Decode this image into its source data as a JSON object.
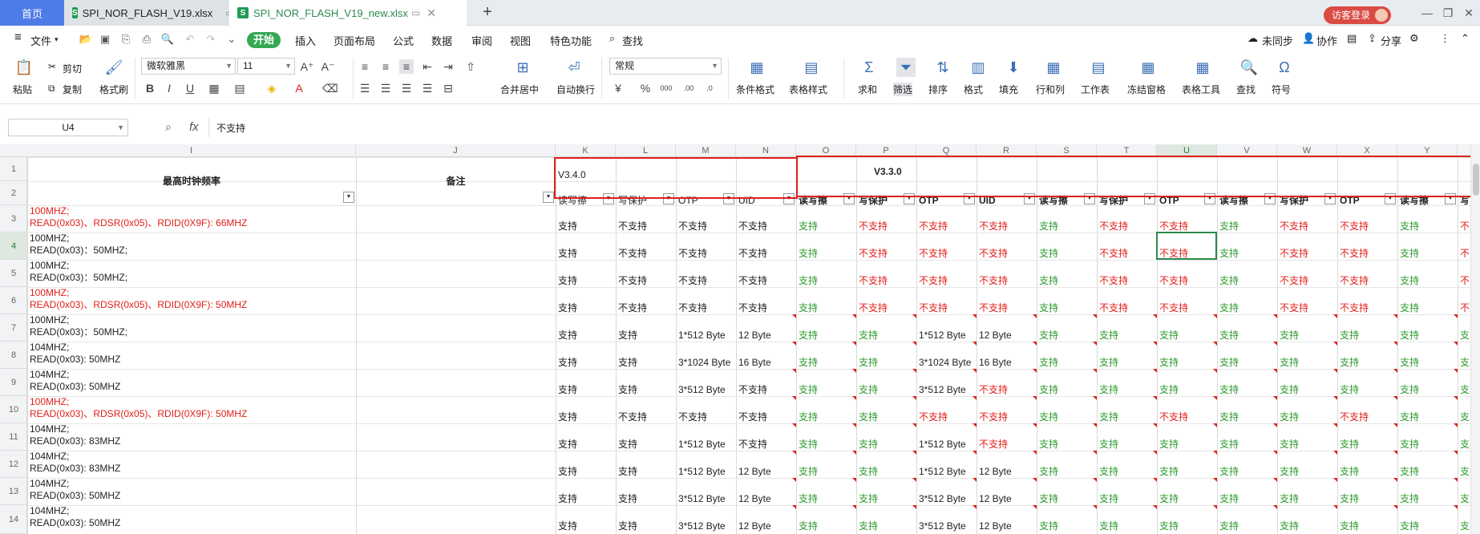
{
  "tabs": {
    "home": "首页",
    "file1": "SPI_NOR_FLASH_V19.xlsx",
    "file2": "SPI_NOR_FLASH_V19_new.xlsx",
    "new_tab": "+",
    "guest_login": "访客登录"
  },
  "menu": {
    "file": "文件",
    "start": "开始",
    "insert": "插入",
    "page_layout": "页面布局",
    "formula": "公式",
    "data": "数据",
    "review": "审阅",
    "view": "视图",
    "special": "特色功能",
    "search": "查找",
    "unsynced": "未同步",
    "collab": "协作",
    "share": "分享"
  },
  "ribbon": {
    "paste": "粘贴",
    "cut": "剪切",
    "copy": "复制",
    "format_painter": "格式刷",
    "font_name": "微软雅黑",
    "font_size": "11",
    "merge_center": "合并居中",
    "auto_wrap": "自动换行",
    "number_format": "常规",
    "conditional_format": "条件格式",
    "table_style": "表格样式",
    "sum": "求和",
    "filter": "筛选",
    "sort": "排序",
    "format": "格式",
    "fill": "填充",
    "row_col": "行和列",
    "worksheet": "工作表",
    "freeze": "冻结窗格",
    "table_tools": "表格工具",
    "find": "查找",
    "symbol": "符号"
  },
  "formula_bar": {
    "cell_ref": "U4",
    "fx": "fx",
    "value": "不支持"
  },
  "columns": [
    "I",
    "J",
    "K",
    "L",
    "M",
    "N",
    "O",
    "P",
    "Q",
    "R",
    "S",
    "T",
    "U",
    "V",
    "W",
    "X",
    "Y"
  ],
  "rows": [
    "1",
    "2",
    "3",
    "4",
    "5",
    "6",
    "7",
    "8",
    "9",
    "10",
    "11",
    "12",
    "13",
    "14"
  ],
  "header": {
    "max_clock": "最高时钟频率",
    "remark": "备注",
    "v340": "V3.4.0",
    "v330": "V3.3.0",
    "sub": [
      "读写擦",
      "写保护",
      "OTP",
      "UID",
      "读写擦",
      "写保护",
      "OTP",
      "UID",
      "读写擦",
      "写保护",
      "OTP",
      "读写擦",
      "写保护",
      "OTP",
      "读写擦",
      "写"
    ]
  },
  "clock_rows": [
    {
      "line1": "100MHZ;",
      "line2": "READ(0x03)、RDSR(0x05)、RDID(0X9F): 66MHZ",
      "color": "#e0201b"
    },
    {
      "line1": "100MHZ;",
      "line2": "READ(0x03)：50MHZ;",
      "color": "#222222"
    },
    {
      "line1": "100MHZ;",
      "line2": "READ(0x03)：50MHZ;",
      "color": "#222222"
    },
    {
      "line1": "100MHZ;",
      "line2": "READ(0x03)、RDSR(0x05)、RDID(0X9F): 50MHZ",
      "color": "#e0201b"
    },
    {
      "line1": "100MHZ;",
      "line2": "READ(0x03)：50MHZ;",
      "color": "#222222"
    },
    {
      "line1": "104MHZ;",
      "line2": "READ(0x03): 50MHZ",
      "color": "#222222"
    },
    {
      "line1": "104MHZ;",
      "line2": "READ(0x03): 50MHZ",
      "color": "#222222"
    },
    {
      "line1": "100MHZ;",
      "line2": "READ(0x03)、RDSR(0x05)、RDID(0X9F): 50MHZ",
      "color": "#e0201b"
    },
    {
      "line1": "104MHZ;",
      "line2": "READ(0x03): 83MHZ",
      "color": "#222222"
    },
    {
      "line1": "104MHZ;",
      "line2": "READ(0x03): 83MHZ",
      "color": "#222222"
    },
    {
      "line1": "104MHZ;",
      "line2": "READ(0x03): 50MHZ",
      "color": "#222222"
    },
    {
      "line1": "104MHZ;",
      "line2": "READ(0x03): 50MHZ",
      "color": "#222222"
    },
    {
      "line1": "104MHZ;",
      "line2": "",
      "color": "#222222"
    }
  ],
  "v340_rows": [
    [
      "支持",
      "不支持",
      "不支持",
      "不支持"
    ],
    [
      "支持",
      "不支持",
      "不支持",
      "不支持"
    ],
    [
      "支持",
      "不支持",
      "不支持",
      "不支持"
    ],
    [
      "支持",
      "不支持",
      "不支持",
      "不支持"
    ],
    [
      "支持",
      "支持",
      "1*512 Byte",
      "12 Byte"
    ],
    [
      "支持",
      "支持",
      "3*1024 Byte",
      "16 Byte"
    ],
    [
      "支持",
      "支持",
      "3*512 Byte",
      "不支持"
    ],
    [
      "支持",
      "不支持",
      "不支持",
      "不支持"
    ],
    [
      "支持",
      "支持",
      "1*512 Byte",
      "不支持"
    ],
    [
      "支持",
      "支持",
      "1*512 Byte",
      "12 Byte"
    ],
    [
      "支持",
      "支持",
      "3*512 Byte",
      "12 Byte"
    ],
    [
      "支持",
      "支持",
      "3*512 Byte",
      "12 Byte"
    ]
  ],
  "v330_rows": [
    [
      "支持",
      "不支持",
      "不支持",
      "不支持",
      "支持",
      "不支持",
      "不支持",
      "支持",
      "不支持",
      "不支持",
      "支持",
      "不"
    ],
    [
      "支持",
      "不支持",
      "不支持",
      "不支持",
      "支持",
      "不支持",
      "不支持",
      "支持",
      "不支持",
      "不支持",
      "支持",
      "不"
    ],
    [
      "支持",
      "不支持",
      "不支持",
      "不支持",
      "支持",
      "不支持",
      "不支持",
      "支持",
      "不支持",
      "不支持",
      "支持",
      "不"
    ],
    [
      "支持",
      "不支持",
      "不支持",
      "不支持",
      "支持",
      "不支持",
      "不支持",
      "支持",
      "不支持",
      "不支持",
      "支持",
      "不"
    ],
    [
      "支持",
      "支持",
      "1*512 Byte",
      "12 Byte",
      "支持",
      "支持",
      "支持",
      "支持",
      "支持",
      "支持",
      "支持",
      "支"
    ],
    [
      "支持",
      "支持",
      "3*1024 Byte",
      "16 Byte",
      "支持",
      "支持",
      "支持",
      "支持",
      "支持",
      "支持",
      "支持",
      "支"
    ],
    [
      "支持",
      "支持",
      "3*512 Byte",
      "不支持",
      "支持",
      "支持",
      "支持",
      "支持",
      "支持",
      "支持",
      "支持",
      "支"
    ],
    [
      "支持",
      "支持",
      "不支持",
      "不支持",
      "支持",
      "支持",
      "不支持",
      "支持",
      "支持",
      "不支持",
      "支持",
      "支"
    ],
    [
      "支持",
      "支持",
      "1*512 Byte",
      "不支持",
      "支持",
      "支持",
      "支持",
      "支持",
      "支持",
      "支持",
      "支持",
      "支"
    ],
    [
      "支持",
      "支持",
      "1*512 Byte",
      "12 Byte",
      "支持",
      "支持",
      "支持",
      "支持",
      "支持",
      "支持",
      "支持",
      "支"
    ],
    [
      "支持",
      "支持",
      "3*512 Byte",
      "12 Byte",
      "支持",
      "支持",
      "支持",
      "支持",
      "支持",
      "支持",
      "支持",
      "支"
    ],
    [
      "支持",
      "支持",
      "3*512 Byte",
      "12 Byte",
      "支持",
      "支持",
      "支持",
      "支持",
      "支持",
      "支持",
      "支持",
      "支"
    ]
  ],
  "colors": {
    "supported": "#2c9a2c",
    "unsupported": "#e0201b",
    "accent": "#2a8a4c",
    "home_tab": "#4e7ce6"
  }
}
